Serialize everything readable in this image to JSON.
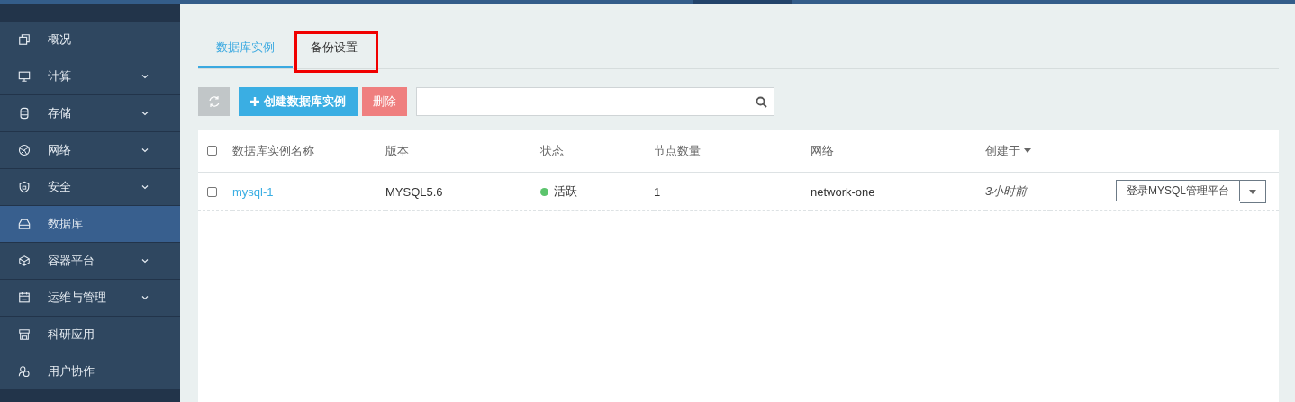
{
  "sidebar": {
    "items": [
      {
        "label": "概况",
        "expandable": false,
        "selected": false
      },
      {
        "label": "计算",
        "expandable": true,
        "selected": false
      },
      {
        "label": "存储",
        "expandable": true,
        "selected": false
      },
      {
        "label": "网络",
        "expandable": true,
        "selected": false
      },
      {
        "label": "安全",
        "expandable": true,
        "selected": false
      },
      {
        "label": "数据库",
        "expandable": false,
        "selected": true
      },
      {
        "label": "容器平台",
        "expandable": true,
        "selected": false
      },
      {
        "label": "运维与管理",
        "expandable": true,
        "selected": false
      },
      {
        "label": "科研应用",
        "expandable": false,
        "selected": false
      },
      {
        "label": "用户协作",
        "expandable": false,
        "selected": false
      }
    ]
  },
  "tabs": [
    {
      "label": "数据库实例",
      "selected": true,
      "highlighted": false
    },
    {
      "label": "备份设置",
      "selected": false,
      "highlighted": true
    }
  ],
  "toolbar": {
    "create_button": "创建数据库实例",
    "delete_button": "删除"
  },
  "table": {
    "select_all_checked": false,
    "columns": [
      {
        "label": "数据库实例名称",
        "sortable": false
      },
      {
        "label": "版本",
        "sortable": false
      },
      {
        "label": "状态",
        "sortable": false
      },
      {
        "label": "节点数量",
        "sortable": false
      },
      {
        "label": "网络",
        "sortable": false
      },
      {
        "label": "创建于",
        "sortable": true
      }
    ],
    "rows": [
      {
        "checked": false,
        "name": "mysql-1",
        "version": "MYSQL5.6",
        "status": "活跃",
        "color": "#5cc46d",
        "nodes": "1",
        "network": "network-one",
        "created": "3小时前",
        "action": "登录MYSQL管理平台"
      }
    ]
  }
}
